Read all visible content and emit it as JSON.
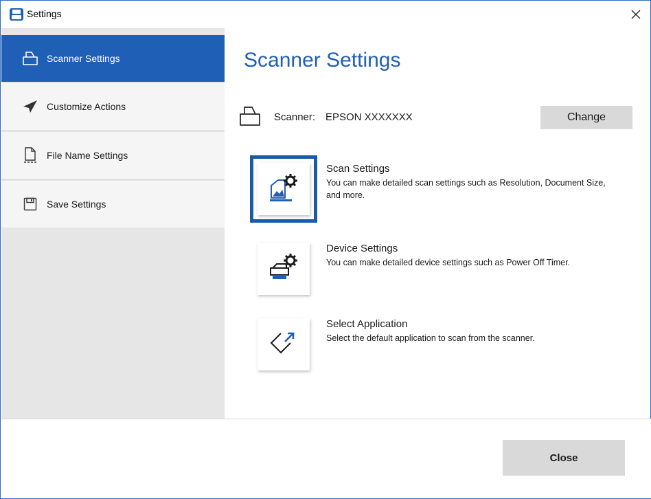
{
  "window": {
    "title": "Settings",
    "app_icon": "save-window-icon",
    "close_icon": "close-icon"
  },
  "colors": {
    "accent": "#1f5fb5",
    "sidebar_bg": "#e6e6e6",
    "button_bg": "#d9d9d9",
    "selection": "#1b5aa8"
  },
  "sidebar": {
    "items": [
      {
        "label": "Scanner Settings",
        "icon": "scanner-icon",
        "active": true
      },
      {
        "label": "Customize Actions",
        "icon": "paper-plane-icon",
        "active": false
      },
      {
        "label": "File Name Settings",
        "icon": "file-icon",
        "active": false
      },
      {
        "label": "Save Settings",
        "icon": "save-icon",
        "active": false
      }
    ]
  },
  "main": {
    "title": "Scanner Settings",
    "scanner": {
      "label": "Scanner:",
      "value": "EPSON XXXXXXX",
      "change_label": "Change"
    },
    "options": [
      {
        "title": "Scan Settings",
        "description": "You can make detailed scan settings such as Resolution, Document Size, and more.",
        "icon": "scan-settings-icon",
        "selected": true
      },
      {
        "title": "Device Settings",
        "description": "You can make detailed device settings such as Power Off Timer.",
        "icon": "device-settings-icon",
        "selected": false
      },
      {
        "title": "Select Application",
        "description": "Select the default application to scan from the scanner.",
        "icon": "select-application-icon",
        "selected": false
      }
    ]
  },
  "footer": {
    "close_label": "Close"
  }
}
